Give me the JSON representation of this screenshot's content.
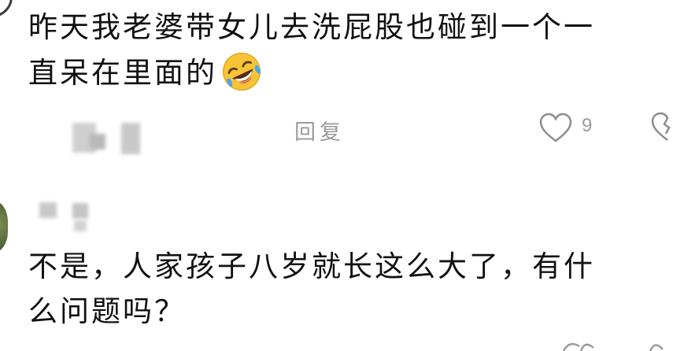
{
  "comments": [
    {
      "line1": "昨天我老婆带女儿去洗屁股也碰到一个一",
      "line2": "直呆在里面的",
      "emoji": "rofl-emoji",
      "reply_label": "回复",
      "like_count": "9"
    },
    {
      "line1": "不是，人家孩子八岁就长这么大了，有什",
      "line2": "么问题吗？"
    }
  ],
  "icons": {
    "like": "heart-outline-icon",
    "dislike": "broken-heart-outline-icon"
  },
  "colors": {
    "text": "#111111",
    "muted": "#9a9a9a",
    "background": "#ffffff"
  }
}
